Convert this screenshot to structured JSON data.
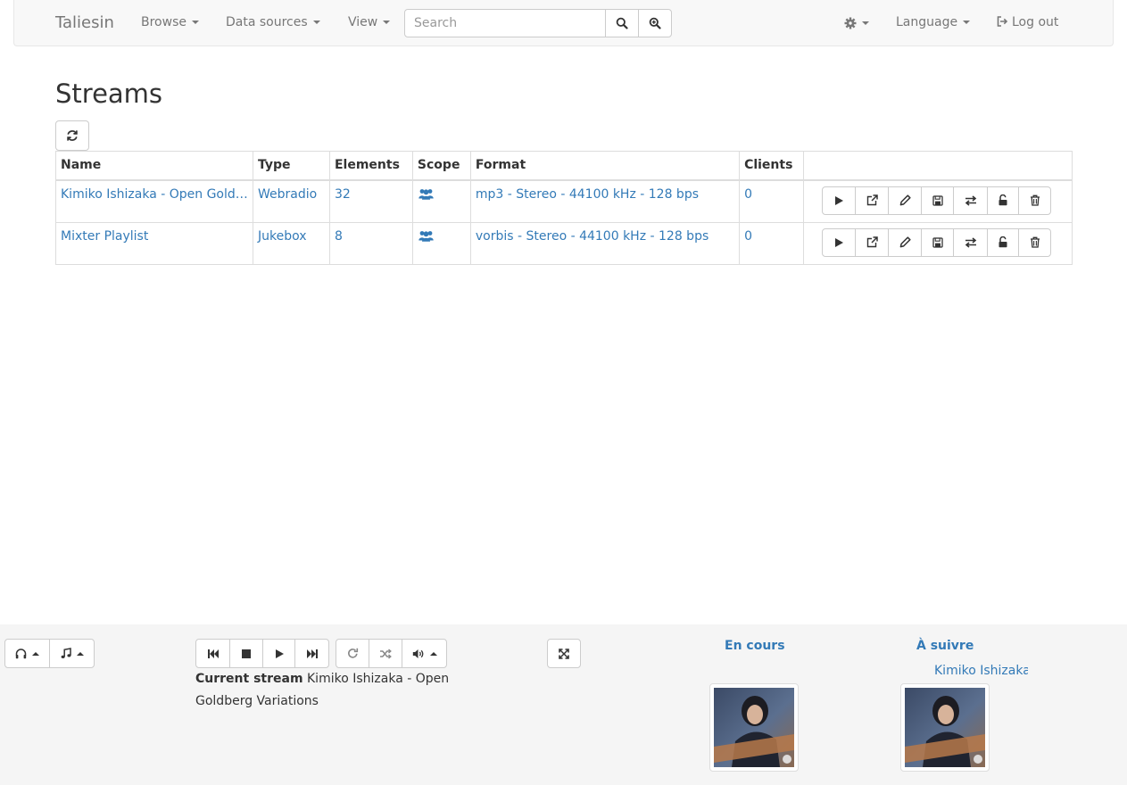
{
  "navbar": {
    "brand": "Taliesin",
    "browse": "Browse",
    "data_sources": "Data sources",
    "view": "View",
    "search_placeholder": "Search",
    "language": "Language",
    "logout": "Log out",
    "icons": [
      "search-icon",
      "advanced-search-icon",
      "gear-icon",
      "logout-icon"
    ]
  },
  "page": {
    "title": "Streams",
    "refresh_icon": "refresh-icon"
  },
  "table": {
    "headers": [
      "Name",
      "Type",
      "Elements",
      "Scope",
      "Format",
      "Clients",
      ""
    ],
    "rows": [
      {
        "name": "Kimiko Ishizaka - Open Goldberg Variations",
        "type": "Webradio",
        "elements": "32",
        "scope_icon": "users-icon",
        "format": "mp3 - Stereo - 44100 kHz - 128 bps",
        "clients": "0"
      },
      {
        "name": "Mixter Playlist",
        "type": "Jukebox",
        "elements": "8",
        "scope_icon": "users-icon",
        "format": "vorbis - Stereo - 44100 kHz - 128 bps",
        "clients": "0"
      }
    ],
    "action_icons": [
      "play-icon",
      "external-link-icon",
      "pencil-icon",
      "save-icon",
      "swap-icon",
      "unlock-icon",
      "trash-icon"
    ]
  },
  "player": {
    "current_label": "Current stream",
    "current_stream": "Kimiko Ishizaka - Open Goldberg Variations",
    "now_playing_label": "En cours",
    "next_label": "À suivre",
    "next_title": "Kimiko Ishizaka - Open Goldberg Variations",
    "icons": [
      "headphones-icon",
      "music-icon",
      "previous-icon",
      "stop-icon",
      "play-icon",
      "next-icon",
      "repeat-icon",
      "shuffle-icon",
      "volume-icon",
      "fullscreen-icon"
    ]
  },
  "colors": {
    "link": "#337ab7",
    "navbar_bg": "#f8f8f8",
    "player_bg": "#f5f5f5",
    "border": "#dddddd"
  }
}
